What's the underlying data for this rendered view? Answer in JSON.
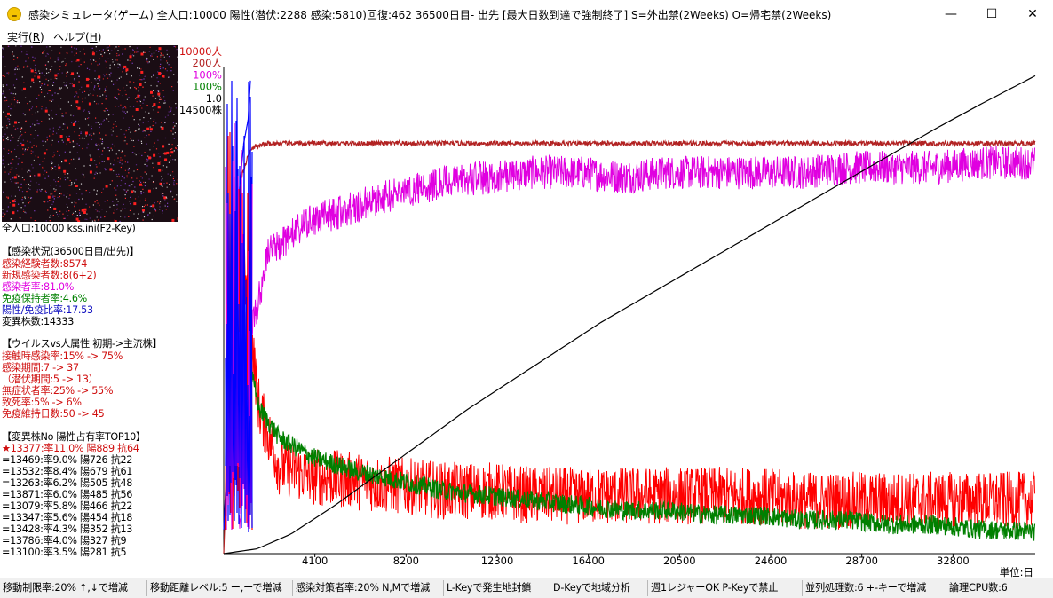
{
  "window": {
    "title": "感染シミュレータ(ゲーム) 全人口:10000 陽性(潜伏:2288 感染:5810)回復:462 36500日目- 出先 [最大日数到達で強制終了]  S=外出禁(2Weeks) O=帰宅禁(2Weeks)",
    "minimize_glyph": "—",
    "maximize_glyph": "☐",
    "close_glyph": "✕"
  },
  "menu": {
    "run_label": "実行(",
    "run_key": "R",
    "help_label": "ヘルプ(",
    "help_key": "H",
    "close_paren": ")"
  },
  "population_line": "全人口:10000  kss.ini(F2-Key)",
  "infection_status": {
    "header": "【感染状況(36500日目/出先)】",
    "lines": [
      {
        "text": "感染経験者数:8574",
        "color": "#d01010"
      },
      {
        "text": "新規感染者数:8(6+2)",
        "color": "#d01010"
      },
      {
        "text": "感染者率:81.0%",
        "color": "#e000e0"
      },
      {
        "text": "免疫保持者率:4.6%",
        "color": "#008000"
      },
      {
        "text": "陽性/免疫比率:17.53",
        "color": "#1010c0"
      },
      {
        "text": "変異株数:14333",
        "color": "#000000"
      }
    ]
  },
  "virus_attributes": {
    "header": "【ウイルスvs人属性 初期->主流株】",
    "lines": [
      "接触時感染率:15% -> 75%",
      "感染期間:7 -> 37",
      "（潜伏期間:5 -> 13）",
      "無症状者率:25% -> 55%",
      "致死率:5% -> 6%",
      "免疫維持日数:50 -> 45"
    ]
  },
  "top_variants": {
    "header": "【変異株No 陽性占有率TOP10】",
    "lines": [
      "★13377:率11.0% 陽889 抗64",
      "=13469:率9.0% 陽726 抗22",
      "=13532:率8.4% 陽679 抗61",
      "=13263:率6.2% 陽505 抗48",
      "=13871:率6.0% 陽485 抗56",
      "=13079:率5.8% 陽466 抗22",
      "=13347:率5.6% 陽454 抗18",
      "=13428:率4.3% 陽352 抗13",
      "=13786:率4.0% 陽327 抗9",
      "=13100:率3.5% 陽281 抗5"
    ]
  },
  "chart_data": {
    "type": "line",
    "x_unit": "単位:日",
    "xlim": [
      0,
      36500
    ],
    "x_ticks": [
      "4100",
      "8200",
      "12300",
      "16400",
      "20500",
      "24600",
      "28700",
      "32800"
    ],
    "y_scale_labels": [
      {
        "text": "10000人",
        "color": "#d01010"
      },
      {
        "text": "200人",
        "color": "#b22222"
      },
      {
        "text": "100%",
        "color": "#e000e0"
      },
      {
        "text": "100%",
        "color": "#008000"
      },
      {
        "text": "1.0",
        "color": "#000000"
      },
      {
        "text": "14500株",
        "color": "#000000"
      }
    ],
    "series": [
      {
        "color": "#b22222",
        "x": [
          0,
          400,
          800,
          1200,
          2000,
          36500
        ],
        "values": [
          0.0,
          0.55,
          0.78,
          0.84,
          0.85,
          0.85
        ]
      },
      {
        "color": "#e000e0",
        "x": [
          700,
          1200,
          2000,
          3000,
          4000,
          6000,
          8000,
          10000,
          12000,
          14000,
          16000,
          18000,
          20000,
          22000,
          24000,
          26000,
          28000,
          30000,
          32000,
          34000,
          36500
        ],
        "values": [
          0.05,
          0.45,
          0.62,
          0.66,
          0.69,
          0.72,
          0.75,
          0.77,
          0.78,
          0.79,
          0.79,
          0.78,
          0.79,
          0.79,
          0.79,
          0.79,
          0.8,
          0.8,
          0.8,
          0.81,
          0.81
        ]
      },
      {
        "color": "#ff0000",
        "x": [
          600,
          1000,
          1600,
          2500,
          4000,
          6000,
          8000,
          10000,
          12000,
          14000,
          16000,
          18000,
          20000,
          22000,
          24000,
          26000,
          28000,
          30000,
          32000,
          34000,
          36500
        ],
        "values": [
          0.7,
          0.55,
          0.3,
          0.18,
          0.16,
          0.15,
          0.14,
          0.13,
          0.13,
          0.12,
          0.12,
          0.12,
          0.12,
          0.12,
          0.12,
          0.11,
          0.11,
          0.11,
          0.11,
          0.11,
          0.11
        ]
      },
      {
        "color": "#008000",
        "x": [
          800,
          1200,
          1600,
          2500,
          4000,
          6000,
          8000,
          10000,
          12000,
          14000,
          16000,
          18000,
          20000,
          22000,
          24000,
          26000,
          28000,
          30000,
          32000,
          34000,
          36500
        ],
        "values": [
          0.3,
          0.38,
          0.3,
          0.24,
          0.2,
          0.17,
          0.15,
          0.13,
          0.12,
          0.11,
          0.1,
          0.09,
          0.09,
          0.08,
          0.08,
          0.07,
          0.07,
          0.06,
          0.06,
          0.05,
          0.046
        ]
      },
      {
        "color": "#000000",
        "x": [
          0,
          1500,
          3000,
          5000,
          8000,
          11000,
          14000,
          17000,
          20000,
          23000,
          26000,
          29000,
          32000,
          34000,
          36500
        ],
        "values": [
          0.0,
          0.01,
          0.04,
          0.1,
          0.2,
          0.3,
          0.39,
          0.48,
          0.56,
          0.64,
          0.72,
          0.8,
          0.88,
          0.93,
          0.99
        ]
      },
      {
        "color": "#0000ff",
        "x": [
          0,
          300,
          600,
          900,
          1100,
          1200
        ],
        "values": [
          0.05,
          0.35,
          0.7,
          0.85,
          0.9,
          0.98
        ]
      }
    ]
  },
  "status_bar": [
    "移動制限率:20% ↑,↓で増減",
    "移動距離レベル:5 ー,ーで増減",
    "感染対策者率:20% N,Mで増減",
    "L-Keyで発生地封鎖",
    "D-Keyで地域分析",
    "週1レジャーOK P-Keyで禁止",
    "並列処理数:6 +-キーで増減",
    "論理CPU数:6"
  ]
}
